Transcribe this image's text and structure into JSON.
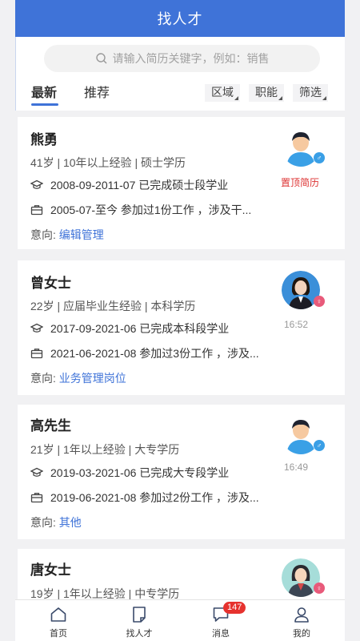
{
  "app": {
    "title": "找人才"
  },
  "search": {
    "placeholder": "请输入简历关键字，例如：销售"
  },
  "tabs": [
    {
      "label": "最新"
    },
    {
      "label": "推荐"
    }
  ],
  "filters": [
    {
      "label": "区域"
    },
    {
      "label": "职能"
    },
    {
      "label": "筛选"
    }
  ],
  "candidates": [
    {
      "name": "熊勇",
      "meta": "41岁 | 10年以上经验 | 硕士学历",
      "education": "2008-09-2011-07 已完成硕士段学业",
      "work": "2005-07-至今 参加过1份工作 ，涉及干...",
      "intent_label": "意向:",
      "intent_value": "编辑管理",
      "badge": "置顶简历",
      "gender": "male"
    },
    {
      "name": "曾女士",
      "meta": "22岁 | 应届毕业生经验 | 本科学历",
      "education": "2017-09-2021-06 已完成本科段学业",
      "work": "2021-06-2021-08 参加过3份工作 ，涉及...",
      "intent_label": "意向:",
      "intent_value": "业务管理岗位",
      "time": "16:52",
      "gender": "female"
    },
    {
      "name": "高先生",
      "meta": "21岁 | 1年以上经验 | 大专学历",
      "education": "2019-03-2021-06 已完成大专段学业",
      "work": "2019-06-2021-08 参加过2份工作 ，涉及...",
      "intent_label": "意向:",
      "intent_value": "其他",
      "time": "16:49",
      "gender": "male"
    },
    {
      "name": "唐女士",
      "meta": "19岁 | 1年以上经验 | 中专学历",
      "gender": "female"
    }
  ],
  "nav": [
    {
      "label": "首页",
      "icon": "home-icon"
    },
    {
      "label": "找人才",
      "icon": "document-icon"
    },
    {
      "label": "消息",
      "icon": "message-icon",
      "badge": "147"
    },
    {
      "label": "我的",
      "icon": "user-icon"
    }
  ],
  "colors": {
    "primary": "#3f73d8",
    "badge": "#e6322e",
    "pin": "#dd3333"
  }
}
